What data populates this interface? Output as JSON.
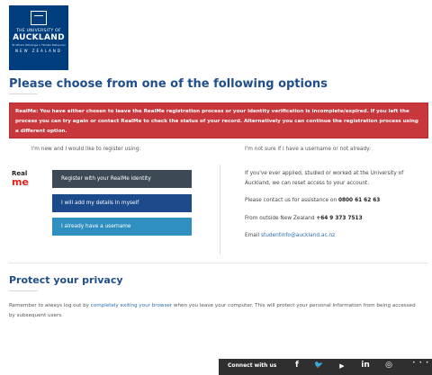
{
  "logo": {
    "line1": "THE UNIVERSITY OF",
    "line2": "AUCKLAND",
    "line3": "Te Whare Wānanga o Tāmaki Makaurau",
    "line4": "NEW ZEALAND"
  },
  "page_title": "Please choose from one of the following options",
  "alert": {
    "text": "RealMe: You have either chosen to leave the RealMe registration process or your identity verification is incomplete/expired. If you left the process you can try again or contact RealMe to check the status of your record. Alternatively you can continue the registration process using a different option."
  },
  "left_column": {
    "heading": "I'm new and I would like to register using:",
    "realme_logo_top": "Real",
    "realme_logo_bottom": "me",
    "buttons": {
      "realme": "Register with your RealMe identity",
      "manual": "I will add my details in myself",
      "existing": "I already have a username"
    }
  },
  "right_column": {
    "heading": "I'm not sure if I have a username or not already:",
    "para1": "If you've ever applied, studied or worked at the University of Auckland, we can reset access to your account.",
    "contact_prefix": "Please contact us for assistance on ",
    "contact_phone": "0800 61 62 63",
    "outside_prefix": "From outside New Zealand ",
    "outside_phone": "+64 9 373 7513",
    "email_prefix": "Email ",
    "email": "studentinfo@auckland.ac.nz"
  },
  "privacy": {
    "title": "Protect your privacy",
    "text_before": "Remember to always log out by ",
    "link": "completely exiting your browser",
    "text_after": " when you leave your computer. This will protect your personal information from being accessed by subsequent users."
  },
  "footer": {
    "connect_label": "Connect with us",
    "icons": {
      "facebook": "f",
      "twitter": "🐦",
      "youtube": "▶",
      "linkedin": "in",
      "instagram": "◎"
    },
    "more": "• • •"
  }
}
